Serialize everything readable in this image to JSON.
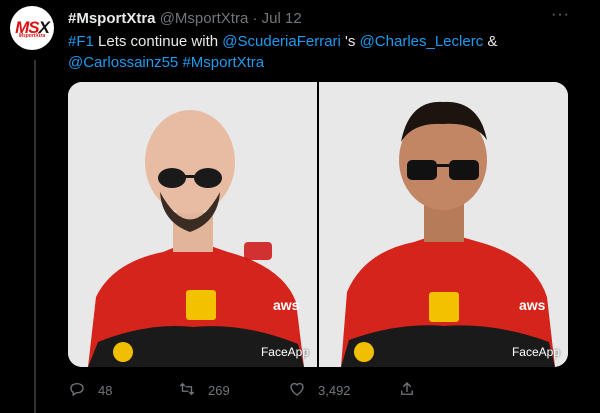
{
  "tweet": {
    "display_name": "#MsportXtra",
    "handle": "@MsportXtra",
    "separator": "·",
    "date": "Jul 12",
    "text_parts": {
      "tag1": "#F1",
      "t1": " Lets continue with ",
      "mention1": "@ScuderiaFerrari",
      "t2": " 's ",
      "mention2": "@Charles_Leclerc",
      "t3": " &",
      "mention3": "@Carlossainz55",
      "t4": " ",
      "tag2": "#MsportXtra"
    },
    "avatar_text": {
      "m": "MS",
      "x": "X",
      "sub": "MsportXtra"
    },
    "more_label": "···",
    "media": [
      {
        "watermark": "FaceApp",
        "overlay_brand": "aws",
        "sponsor": "Ferrari"
      },
      {
        "watermark": "FaceApp",
        "overlay_brand": "aws",
        "sponsor": "Ferrari"
      }
    ],
    "stats": {
      "replies": "48",
      "retweets": "269",
      "likes": "3,492"
    }
  },
  "colors": {
    "accent": "#1d9bf0",
    "background": "#000000",
    "muted": "#71767b",
    "suit_red": "#d4241c"
  },
  "icons": [
    "reply-icon",
    "retweet-icon",
    "like-icon",
    "share-icon",
    "more-icon"
  ]
}
